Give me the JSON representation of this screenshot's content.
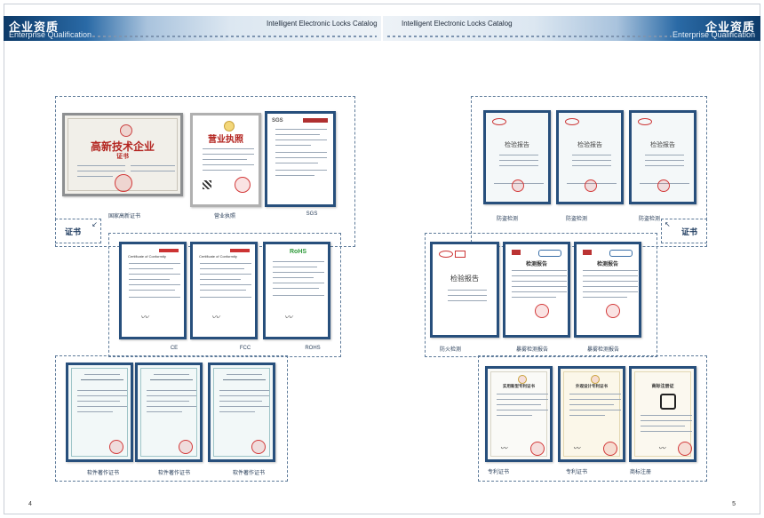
{
  "header": {
    "left_zh": "企业资质",
    "left_en": "Enterprise Qualification",
    "right_zh": "企业资质",
    "right_en": "Enterprise Qualification",
    "catalog_left": "Intelligent Electronic Locks Catalog",
    "catalog_right": "Intelligent Electronic Locks Catalog"
  },
  "labels": {
    "left_cert": "证书",
    "right_cert": "证书"
  },
  "left_page": {
    "group1": [
      {
        "caption": "国家高新证书",
        "title": "高新技术企业",
        "subtitle": "证书"
      },
      {
        "caption": "营业执照",
        "title": "营业执照"
      },
      {
        "caption": "SGS",
        "title": "SGS"
      }
    ],
    "group2": [
      {
        "caption": "CE",
        "title": "Certificate of Conformity"
      },
      {
        "caption": "FCC",
        "title": "Certificate of Conformity"
      },
      {
        "caption": "ROHS",
        "title": "RoHS"
      }
    ],
    "group3": [
      {
        "caption": "软件著作证书"
      },
      {
        "caption": "软件著作证书"
      },
      {
        "caption": "软件著作证书"
      }
    ],
    "page_number": "4"
  },
  "right_page": {
    "group1": [
      {
        "caption": "防盗检测",
        "title": "检验报告"
      },
      {
        "caption": "防盗检测",
        "title": "检验报告"
      },
      {
        "caption": "防盗检测",
        "title": "检验报告"
      }
    ],
    "group2": [
      {
        "caption": "防火检测",
        "title": "检验报告"
      },
      {
        "caption": "暴雾检测报告",
        "title": "检测报告"
      },
      {
        "caption": "暴雾检测报告",
        "title": "检测报告"
      }
    ],
    "group3": [
      {
        "caption": "专利证书",
        "title": "实用新型专利证书"
      },
      {
        "caption": "专利证书",
        "title": "外观设计专利证书"
      },
      {
        "caption": "商标注册",
        "title": "商标注册证"
      }
    ],
    "page_number": "5"
  },
  "colors": {
    "navy": "#0d3a68",
    "frame": "#274f7c",
    "seal_red": "#d33a3a"
  }
}
